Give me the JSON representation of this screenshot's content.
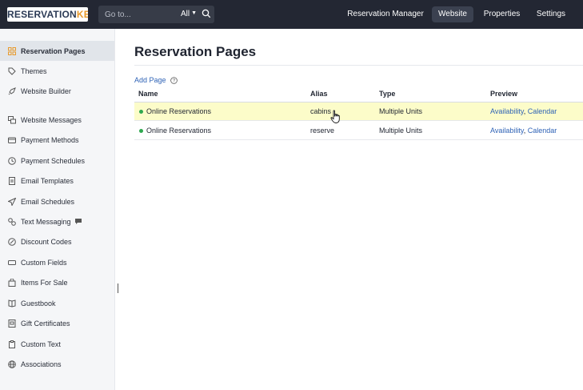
{
  "header": {
    "logo": {
      "part1": "RESERVATION",
      "part2": "KEY"
    },
    "search": {
      "placeholder": "Go to...",
      "scope": "All"
    },
    "nav": [
      {
        "label": "Reservation Manager",
        "active": false
      },
      {
        "label": "Website",
        "active": true
      },
      {
        "label": "Properties",
        "active": false
      },
      {
        "label": "Settings",
        "active": false
      }
    ]
  },
  "sidebar": {
    "items": [
      {
        "label": "Reservation Pages",
        "icon": "grid-icon",
        "active": true
      },
      {
        "label": "Themes",
        "icon": "tag-icon"
      },
      {
        "label": "Website Builder",
        "icon": "rocket-icon"
      },
      {
        "label": "Website Messages",
        "icon": "messages-icon"
      },
      {
        "label": "Payment Methods",
        "icon": "credit-card-icon"
      },
      {
        "label": "Payment Schedules",
        "icon": "clock-icon"
      },
      {
        "label": "Email Templates",
        "icon": "document-icon"
      },
      {
        "label": "Email Schedules",
        "icon": "send-icon"
      },
      {
        "label": "Text Messaging",
        "icon": "sms-icon"
      },
      {
        "label": "Discount Codes",
        "icon": "discount-icon"
      },
      {
        "label": "Custom Fields",
        "icon": "field-icon"
      },
      {
        "label": "Items For Sale",
        "icon": "bag-icon"
      },
      {
        "label": "Guestbook",
        "icon": "book-icon"
      },
      {
        "label": "Gift Certificates",
        "icon": "gift-icon"
      },
      {
        "label": "Custom Text",
        "icon": "clipboard-icon"
      },
      {
        "label": "Associations",
        "icon": "globe-icon"
      }
    ]
  },
  "main": {
    "title": "Reservation Pages",
    "add_page_label": "Add Page",
    "table": {
      "columns": [
        "Name",
        "Alias",
        "Type",
        "Preview"
      ],
      "rows": [
        {
          "name": "Online Reservations",
          "alias": "cabins",
          "type": "Multiple Units",
          "preview_1": "Availability",
          "preview_sep": ",",
          "preview_2": "Calendar",
          "highlighted": true,
          "status": "active"
        },
        {
          "name": "Online Reservations",
          "alias": "reserve",
          "type": "Multiple Units",
          "preview_1": "Availability",
          "preview_sep": ",",
          "preview_2": "Calendar",
          "highlighted": false,
          "status": "active"
        }
      ]
    }
  },
  "colors": {
    "topbar": "#232733",
    "logo_key": "#e89a2c",
    "link": "#2f63b6",
    "row_highlight": "#fcfcc9",
    "status_active": "#2fa84f"
  }
}
